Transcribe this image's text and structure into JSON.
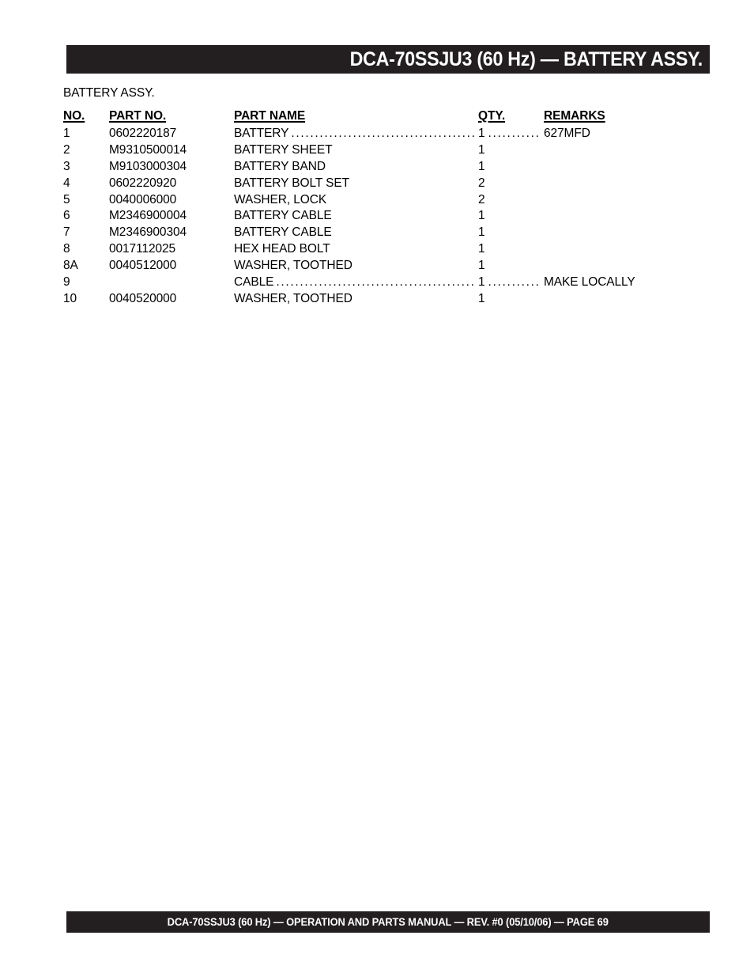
{
  "header": {
    "title": "DCA-70SSJU3 (60 Hz) — BATTERY ASSY."
  },
  "section": {
    "caption": "BATTERY ASSY."
  },
  "table": {
    "columns": {
      "no": "NO.",
      "part_no": "PART NO.",
      "part_name": "PART NAME",
      "qty": "QTY.",
      "remarks": "REMARKS"
    },
    "rows": [
      {
        "no": "1",
        "part_no": "0602220187",
        "part_name": "BATTERY",
        "qty": "1",
        "remarks": "627MFD",
        "leader": true
      },
      {
        "no": "2",
        "part_no": "M9310500014",
        "part_name": "BATTERY SHEET",
        "qty": "1",
        "remarks": "",
        "leader": false
      },
      {
        "no": "3",
        "part_no": "M9103000304",
        "part_name": "BATTERY BAND",
        "qty": "1",
        "remarks": "",
        "leader": false
      },
      {
        "no": "4",
        "part_no": "0602220920",
        "part_name": "BATTERY BOLT SET",
        "qty": "2",
        "remarks": "",
        "leader": false
      },
      {
        "no": "5",
        "part_no": "0040006000",
        "part_name": "WASHER, LOCK",
        "qty": "2",
        "remarks": "",
        "leader": false
      },
      {
        "no": "6",
        "part_no": "M2346900004",
        "part_name": "BATTERY CABLE",
        "qty": "1",
        "remarks": "",
        "leader": false
      },
      {
        "no": "7",
        "part_no": "M2346900304",
        "part_name": "BATTERY CABLE",
        "qty": "1",
        "remarks": "",
        "leader": false
      },
      {
        "no": "8",
        "part_no": "0017112025",
        "part_name": "HEX HEAD BOLT",
        "qty": "1",
        "remarks": "",
        "leader": false
      },
      {
        "no": "8A",
        "part_no": "0040512000",
        "part_name": "WASHER, TOOTHED",
        "qty": "1",
        "remarks": "",
        "leader": false
      },
      {
        "no": "9",
        "part_no": "",
        "part_name": "CABLE",
        "qty": "1",
        "remarks": "MAKE LOCALLY",
        "leader": true
      },
      {
        "no": "10",
        "part_no": "0040520000",
        "part_name": "WASHER, TOOTHED",
        "qty": "1",
        "remarks": "",
        "leader": false
      }
    ]
  },
  "footer": {
    "text": "DCA-70SSJU3 (60 Hz) — OPERATION AND PARTS MANUAL — REV. #0  (05/10/06) — PAGE 69"
  },
  "colors": {
    "bar": "#231f20",
    "bar_text": "#ffffff",
    "page": "#ffffff",
    "body_text": "#000000"
  }
}
